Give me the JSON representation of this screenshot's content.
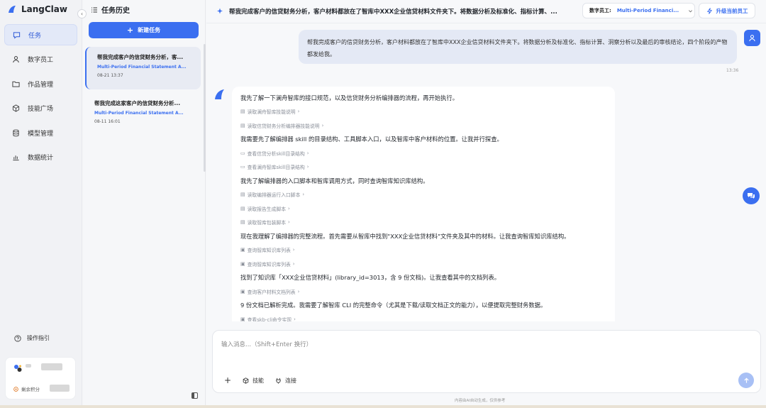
{
  "app": {
    "name": "LangClaw"
  },
  "nav": {
    "items": [
      {
        "label": "任务",
        "icon": "chat-icon",
        "active": true
      },
      {
        "label": "数字员工",
        "icon": "user-icon"
      },
      {
        "label": "作品管理",
        "icon": "folder-icon"
      },
      {
        "label": "技能广场",
        "icon": "cube-icon"
      },
      {
        "label": "模型管理",
        "icon": "database-icon"
      },
      {
        "label": "数据统计",
        "icon": "bar-chart-icon"
      }
    ],
    "guide": "操作指引",
    "points_label": "剩余积分"
  },
  "tasks": {
    "title": "任务历史",
    "new_task": "新建任务",
    "items": [
      {
        "title": "帮我完成客户的信贷财务分析，客...",
        "sub": "Multi-Period Financial Statement A...",
        "time": "08-21 13:37"
      },
      {
        "title": "帮我完成这家客户的信贷财务分析...",
        "sub": "Multi-Period Financial Statement A...",
        "time": "08-11 16:01"
      }
    ]
  },
  "topbar": {
    "title": "帮我完成客户的信贷财务分析，客户材料都放在了智库中XXX企业信贷材料文件夹下。将数据分析及标准化、指标计算、...",
    "employee_label": "数字员工:",
    "employee_value": "Multi-Period Financi...",
    "upgrade": "升级当前员工"
  },
  "chat": {
    "user_message": "帮我完成客户的信贷财务分析，客户材料都放在了智库中XXX企业信贷材料文件夹下。将数据分析及标准化、指标计算、洞察分析以及最后的审核结论，四个阶段的产物都发给我。",
    "user_time": "13:36",
    "assistant_lines": [
      {
        "kind": "text",
        "text": "我先了解一下澜舟智库的接口规范，以及信贷财务分析编排器的流程，再开始执行。"
      },
      {
        "kind": "tool",
        "icon": "doc-icon",
        "text": "读取澜舟智库技能说明"
      },
      {
        "kind": "tool",
        "icon": "doc-icon",
        "text": "读取信贷财务分析编排器技能说明"
      },
      {
        "kind": "text",
        "text": "我需要先了解编排器 skill 的目录结构、工具脚本入口，以及智库中客户材料的位置。让我并行探查。"
      },
      {
        "kind": "tool",
        "icon": "folder-icon",
        "text": "查看信贷分析skill目录结构"
      },
      {
        "kind": "tool",
        "icon": "folder-icon",
        "text": "查看澜舟智库skill目录结构"
      },
      {
        "kind": "text",
        "text": "我先了解编排器的入口脚本和智库调用方式，同时查询智库知识库结构。"
      },
      {
        "kind": "tool",
        "icon": "doc-icon",
        "text": "读取编排器运行入口脚本"
      },
      {
        "kind": "tool",
        "icon": "doc-icon",
        "text": "读取报告生成脚本"
      },
      {
        "kind": "tool",
        "icon": "doc-icon",
        "text": "读取智库包装脚本"
      },
      {
        "kind": "text",
        "text": "现在我理解了编排器的完整流程。首先需要从智库中找到\"XXX企业信贷材料\"文件夹及其中的材料。让我查询智库知识库结构。"
      },
      {
        "kind": "tool",
        "icon": "terminal-icon",
        "text": "查询智库知识库列表"
      },
      {
        "kind": "tool",
        "icon": "terminal-icon",
        "text": "查询智库知识库列表"
      },
      {
        "kind": "text",
        "text": "找到了知识库「XXX企业信贷材料」(library_id=3013，含 9 份文档)。让我查看其中的文档列表。"
      },
      {
        "kind": "tool",
        "icon": "terminal-icon",
        "text": "查询客户材料文档列表"
      },
      {
        "kind": "text",
        "text": "9 份文档已解析完成。我需要了解智库 CLI 的完整命令（尤其是下载/读取文档正文的能力），以便提取完整财务数据。"
      },
      {
        "kind": "tool",
        "icon": "terminal-icon",
        "text": "查看skb-cli命令实现"
      }
    ]
  },
  "composer": {
    "placeholder": "输入消息...（Shift+Enter 换行）",
    "skill": "技能",
    "connect": "连接"
  },
  "footer": "内容由AI自动生成，仅供参考",
  "colors": {
    "accent": "#3b6ff0",
    "user_bubble": "#e4e9f5"
  }
}
